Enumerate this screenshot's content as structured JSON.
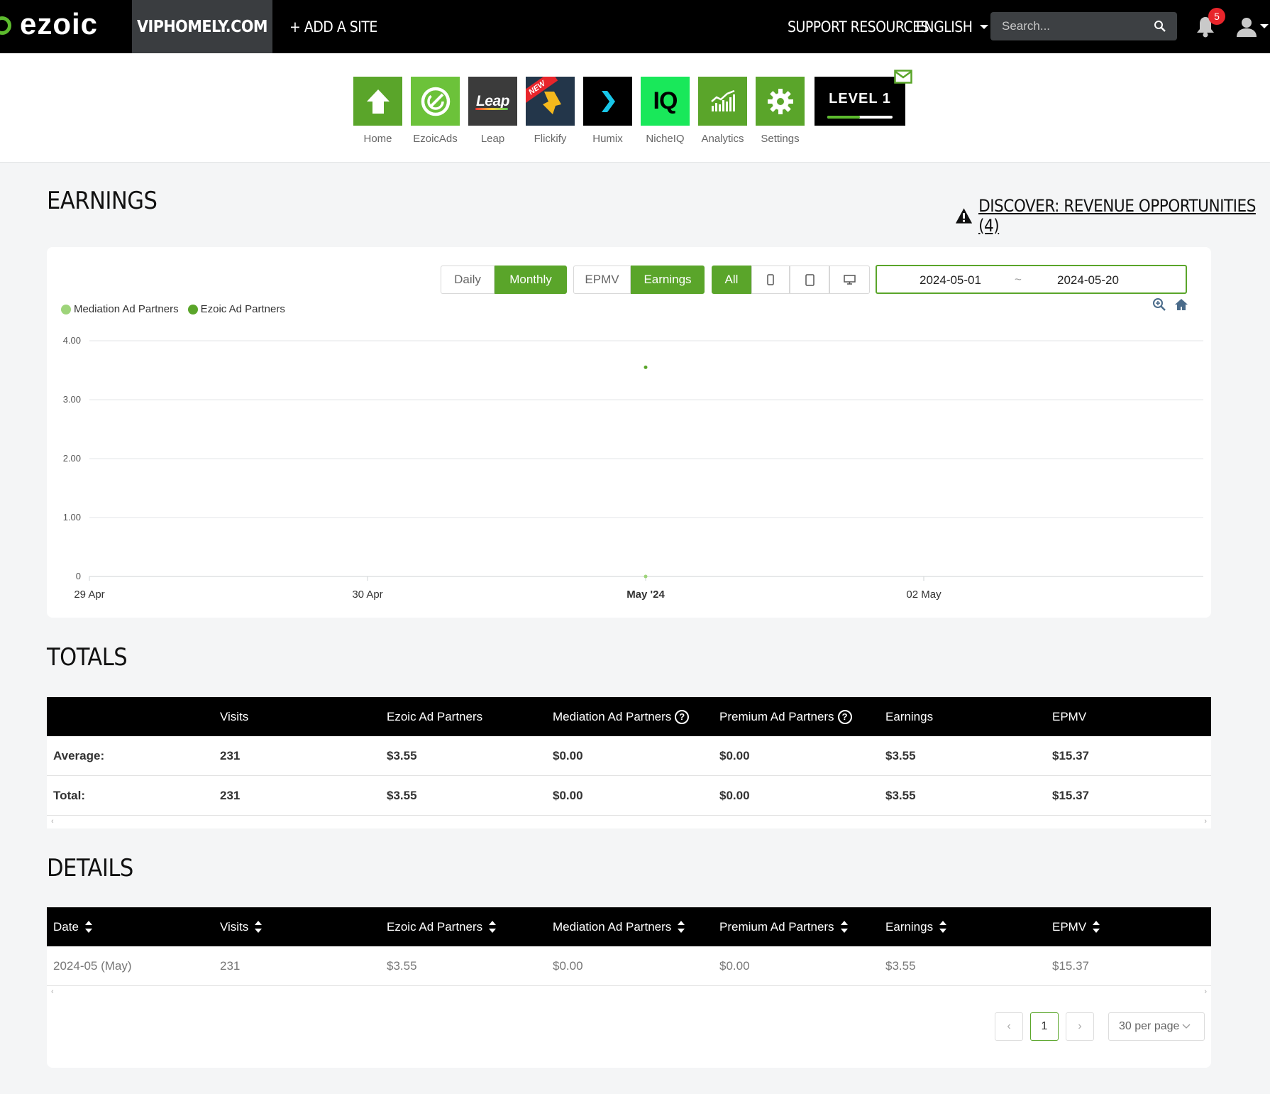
{
  "topbar": {
    "logo_text": "ezoic",
    "site": "VIPHOMELY.COM",
    "add_site": "+ ADD A SITE",
    "support": "SUPPORT RESOURCES",
    "language": "ENGLISH",
    "search_placeholder": "Search...",
    "notifications": "5"
  },
  "apps": [
    {
      "label": "Home",
      "color": "#5aa52a"
    },
    {
      "label": "EzoicAds",
      "color": "#6cc23a"
    },
    {
      "label": "Leap",
      "color": "#3b3b3b",
      "tile_text": "Leap"
    },
    {
      "label": "Flickify",
      "color": "#23364a",
      "ribbon": "NEW"
    },
    {
      "label": "Humix",
      "color": "#000000"
    },
    {
      "label": "NicheIQ",
      "color": "#19e85a",
      "tile_text": "IQ"
    },
    {
      "label": "Analytics",
      "color": "#5aa52a"
    },
    {
      "label": "Settings",
      "color": "#5aa52a"
    }
  ],
  "level": {
    "label": "LEVEL 1",
    "progress": 0.5
  },
  "earnings": {
    "title": "EARNINGS",
    "discover": "DISCOVER: REVENUE OPPORTUNITIES (4)",
    "period_buttons": [
      "Daily",
      "Monthly"
    ],
    "period_selected": "Monthly",
    "metric_buttons": [
      "EPMV",
      "Earnings"
    ],
    "metric_selected": "Earnings",
    "device_buttons": [
      "All",
      "mobile-icon",
      "tablet-icon",
      "desktop-icon"
    ],
    "device_selected": "All",
    "date_start": "2024-05-01",
    "date_sep": "~",
    "date_end": "2024-05-20"
  },
  "chart_data": {
    "type": "scatter",
    "legend_position": "top-left",
    "series": [
      {
        "name": "Mediation Ad Partners",
        "color": "#9ed47a",
        "points": [
          {
            "x": "May '24",
            "y": 0.0
          }
        ]
      },
      {
        "name": "Ezoic Ad Partners",
        "color": "#5aa52a",
        "points": [
          {
            "x": "May '24",
            "y": 3.55
          }
        ]
      }
    ],
    "x_ticks": [
      "29 Apr",
      "30 Apr",
      "May '24",
      "02 May"
    ],
    "x_tick_bold": "May '24",
    "y_ticks": [
      "0",
      "1.00",
      "2.00",
      "3.00",
      "4.00"
    ],
    "ylim": [
      0,
      4
    ],
    "grid": true
  },
  "totals": {
    "title": "TOTALS",
    "columns": [
      "",
      "Visits",
      "Ezoic Ad Partners",
      "Mediation Ad Partners",
      "Premium Ad Partners",
      "Earnings",
      "EPMV"
    ],
    "rows": [
      [
        "Average:",
        "231",
        "$3.55",
        "$0.00",
        "$0.00",
        "$3.55",
        "$15.37"
      ],
      [
        "Total:",
        "231",
        "$3.55",
        "$0.00",
        "$0.00",
        "$3.55",
        "$15.37"
      ]
    ]
  },
  "details": {
    "title": "DETAILS",
    "columns": [
      "Date",
      "Visits",
      "Ezoic Ad Partners",
      "Mediation Ad Partners",
      "Premium Ad Partners",
      "Earnings",
      "EPMV"
    ],
    "rows": [
      [
        "2024-05 (May)",
        "231",
        "$3.55",
        "$0.00",
        "$0.00",
        "$3.55",
        "$15.37"
      ]
    ],
    "page": "1",
    "per_page": "30 per page"
  }
}
